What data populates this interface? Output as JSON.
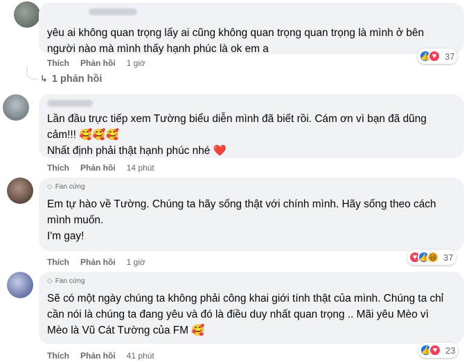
{
  "comments": [
    {
      "fan_badge": "",
      "text": "yêu ai không quan trọng lấy ai cũng không quan trọng quan trọng là mình ở bên người nào mà mình thấy hạnh phúc là ok em a",
      "like_label": "Thích",
      "reply_label": "Phản hồi",
      "time": "1 giờ",
      "reaction_count": "37",
      "reactions": [
        "like-icon",
        "love-icon"
      ]
    },
    {
      "fan_badge": "",
      "text_line1": "Lần đầu trực tiếp xem Tường biểu diễn mình đã biết rồi. Cám ơn vì bạn đã dũng",
      "text_line2": "cảm!!! 🥰🥰🥰",
      "text_line3": "Nhất định phải thật hạnh phúc nhé ❤️",
      "like_label": "Thích",
      "reply_label": "Phản hồi",
      "time": "14 phút"
    },
    {
      "fan_badge": "Fan cứng",
      "text_line1": "Em tự hào về Tường. Chúng ta hãy sống thật với chính mình. Hãy sống theo cách",
      "text_line2": "mình muốn.",
      "text_line3": "I'm gay!",
      "like_label": "Thích",
      "reply_label": "Phản hồi",
      "time": "1 giờ",
      "reaction_count": "37",
      "reactions": [
        "love-icon",
        "like-icon",
        "haha-icon"
      ]
    },
    {
      "fan_badge": "Fan cứng",
      "text_line1": "Sẽ có một ngày chúng ta không phải công khai giới tính thật của mình. Chúng ta chỉ",
      "text_line2": "cần nói là chúng ta đang yêu và đó là điều duy nhất quan trọng .. Mãi yêu Mèo vì",
      "text_line3": "Mèo là Vũ Cát Tường của FM 🥰",
      "like_label": "Thích",
      "reply_label": "Phản hồi",
      "time": "41 phút",
      "reaction_count": "23",
      "reactions": [
        "like-icon",
        "love-icon"
      ]
    }
  ],
  "replies_link": "1 phản hồi",
  "colors": {
    "bubble": "#f0f2f5",
    "meta": "#65676b",
    "like": "#1877f2",
    "love": "#f33e58",
    "haha": "#f7b125"
  }
}
